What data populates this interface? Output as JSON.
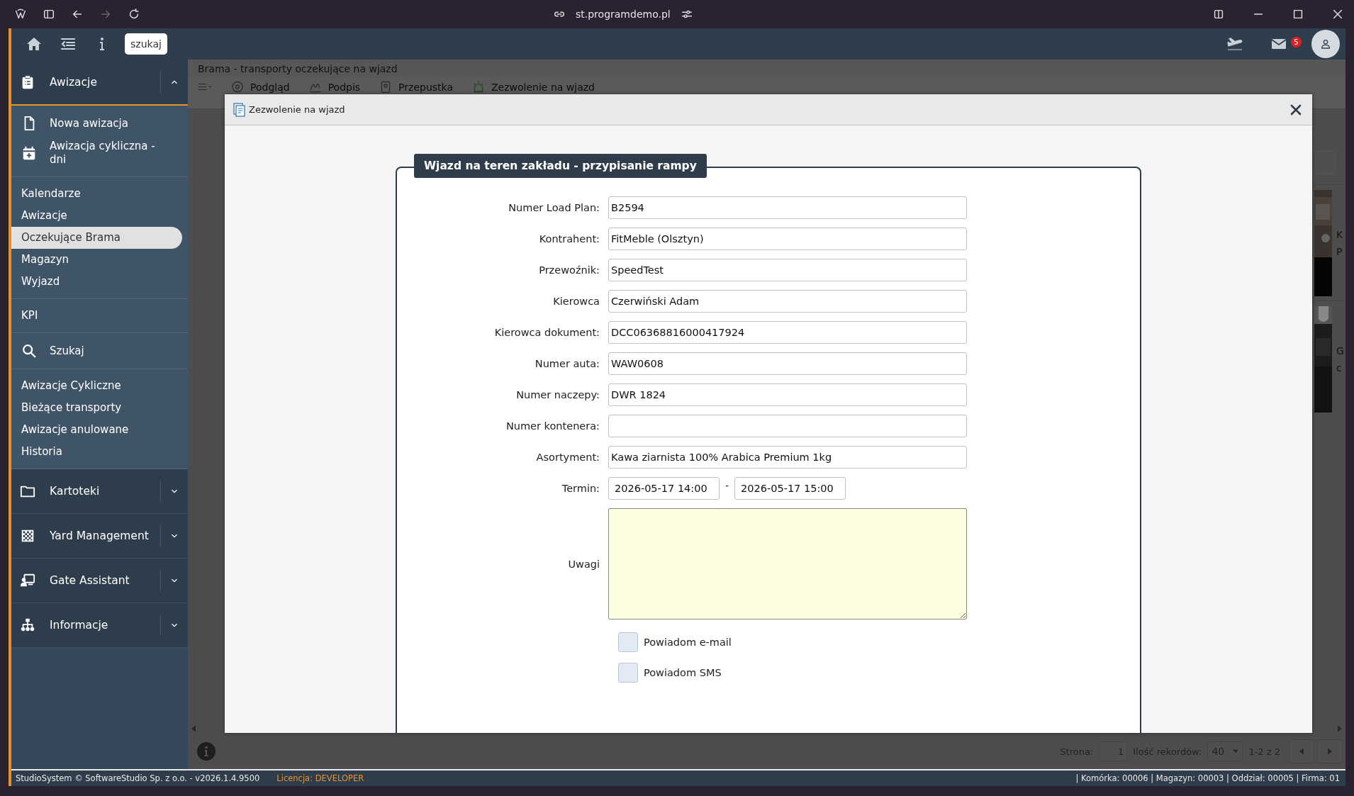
{
  "browser": {
    "url": "st.programdemo.pl"
  },
  "topbar": {
    "search_button": "szukaj",
    "mail_badge": "5"
  },
  "sidebar": {
    "groups": [
      {
        "kind": "header",
        "label": "Awizacje",
        "expanded": true
      },
      {
        "kind": "menu",
        "items": [
          {
            "kind": "icon",
            "label": "Nowa awizacja",
            "selected": false
          },
          {
            "kind": "icon",
            "label": "Awizacja cykliczna - dni",
            "selected": false
          }
        ]
      },
      {
        "kind": "menu",
        "items": [
          {
            "kind": "plain",
            "label": "Kalendarze",
            "selected": false
          },
          {
            "kind": "plain",
            "label": "Awizacje",
            "selected": false
          },
          {
            "kind": "plain",
            "label": "Oczekujące Brama",
            "selected": true
          },
          {
            "kind": "plain",
            "label": "Magazyn",
            "selected": false
          },
          {
            "kind": "plain",
            "label": "Wyjazd",
            "selected": false
          }
        ]
      },
      {
        "kind": "menu",
        "items": [
          {
            "kind": "plain",
            "label": "KPI",
            "selected": false
          }
        ]
      },
      {
        "kind": "menu",
        "items": [
          {
            "kind": "icon",
            "label": "Szukaj",
            "selected": false
          }
        ]
      },
      {
        "kind": "menu",
        "items": [
          {
            "kind": "plain",
            "label": "Awizacje Cykliczne",
            "selected": false
          },
          {
            "kind": "plain",
            "label": "Bieżące transporty",
            "selected": false
          },
          {
            "kind": "plain",
            "label": "Awizacje anulowane",
            "selected": false
          },
          {
            "kind": "plain",
            "label": "Historia",
            "selected": false
          }
        ]
      },
      {
        "kind": "header",
        "label": "Kartoteki",
        "expanded": false
      },
      {
        "kind": "header",
        "label": "Yard Management",
        "expanded": false
      },
      {
        "kind": "header",
        "label": "Gate Assistant",
        "expanded": false
      },
      {
        "kind": "header",
        "label": "Informacje",
        "expanded": false
      }
    ]
  },
  "main": {
    "title": "Brama - transporty oczekujące na wjazd",
    "toolbar": [
      "Podgląd",
      "Podpis",
      "Przepustka",
      "Zezwolenie na wjazd"
    ],
    "rows": [
      {
        "kind": "picture",
        "column_2": "K",
        "column_3": "P"
      },
      {
        "kind": "picture",
        "column_2": "G",
        "column_3": "c"
      }
    ],
    "pager": {
      "page_label": "Strona:",
      "page": "1",
      "records_label": "Ilość rekordów:",
      "records": "40",
      "range": "1-2 z 2"
    }
  },
  "dialog": {
    "title": "Zezwolenie na wjazd",
    "legend": "Wjazd na teren zakładu - przypisanie rampy",
    "fields": [
      {
        "kind": "text",
        "label": "Numer Load Plan:",
        "value": "B2594"
      },
      {
        "kind": "text",
        "label": "Kontrahent:",
        "value": "FitMeble (Olsztyn)"
      },
      {
        "kind": "text",
        "label": "Przewoźnik:",
        "value": "SpeedTest"
      },
      {
        "kind": "text",
        "label": "Kierowca",
        "value": "Czerwiński Adam"
      },
      {
        "kind": "text",
        "label": "Kierowca dokument:",
        "value": "DCC06368816000417924"
      },
      {
        "kind": "text",
        "label": "Numer auta:",
        "value": "WAW0608"
      },
      {
        "kind": "text",
        "label": "Numer naczepy:",
        "value": "DWR 1824"
      },
      {
        "kind": "text",
        "label": "Numer kontenera:"
      },
      {
        "kind": "text",
        "label": "Asortyment:",
        "value": "Kawa ziarnista 100% Arabica Premium 1kg"
      },
      {
        "kind": "range",
        "label": "Termin:",
        "from": "2026-05-17 14:00",
        "separator": "-",
        "to": "2026-05-17 15:00"
      },
      {
        "kind": "textarea",
        "label": "Uwagi"
      }
    ],
    "checkboxes": [
      {
        "label": "Powiadom e-mail",
        "checked": false
      },
      {
        "label": "Powiadom SMS",
        "checked": false
      }
    ]
  },
  "footer": {
    "copyright": "StudioSystem © SoftwareStudio Sp. z o.o. - v2026.1.4.9500",
    "license_label": "Licencja:",
    "license": "DEVELOPER",
    "info": "| Komórka: 00006 | Magazyn: 00003 | Oddział: 00005 | Firma: 01"
  }
}
